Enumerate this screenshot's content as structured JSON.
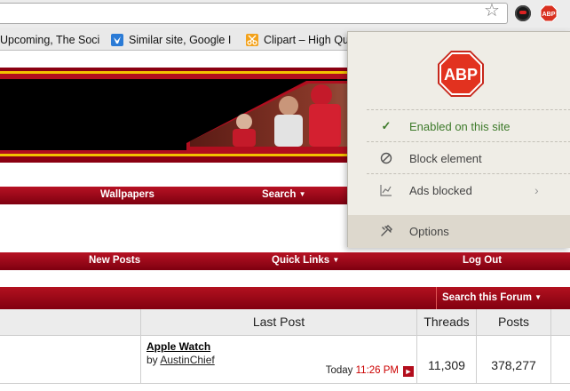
{
  "bookmarks": [
    {
      "label": "Upcoming, The Soci",
      "icon": "bookmark-page-icon"
    },
    {
      "label": "Similar site, Google I",
      "icon": "bird-icon"
    },
    {
      "label": "Clipart – High Qu",
      "icon": "scissors-icon"
    }
  ],
  "extensions": {
    "abp_badge": "ABP"
  },
  "nav_top": {
    "wallpapers": "Wallpapers",
    "search": "Search"
  },
  "nav_second": {
    "new_posts": "New Posts",
    "quick_links": "Quick Links",
    "log_out": "Log Out"
  },
  "forum": {
    "search_this_forum": "Search this Forum",
    "columns": {
      "last_post": "Last Post",
      "threads": "Threads",
      "posts": "Posts"
    },
    "rows": [
      {
        "last_post_title": "Apple Watch",
        "by": "by",
        "user": "AustinChief",
        "day": "Today",
        "time": "11:26 PM",
        "threads": "11,309",
        "posts": "378,277"
      }
    ]
  },
  "abp_popup": {
    "logo_text": "ABP",
    "items": [
      {
        "label": "Enabled on this site",
        "icon": "check-icon"
      },
      {
        "label": "Block element",
        "icon": "block-icon"
      },
      {
        "label": "Ads blocked",
        "icon": "chart-icon"
      },
      {
        "label": "Options",
        "icon": "wrench-icon"
      }
    ]
  },
  "colors": {
    "brand_red": "#b30d1c",
    "enabled_green": "#3d7a2a",
    "popup_bg": "#efede6"
  }
}
